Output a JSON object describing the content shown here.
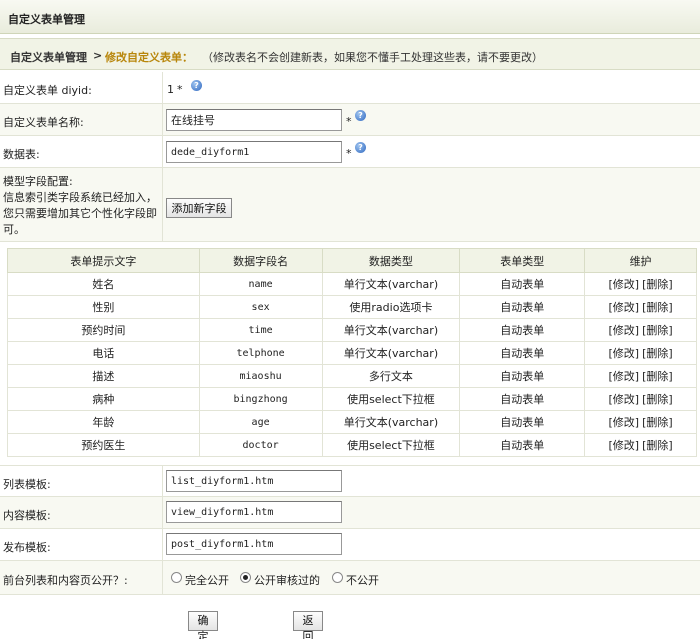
{
  "header": {
    "title": "自定义表单管理"
  },
  "breadcrumb": {
    "root": "自定义表单管理",
    "separator": ">",
    "current": "修改自定义表单：",
    "note": "（修改表名不会创建新表，如果您不懂手工处理这些表，请不要更改）"
  },
  "form": {
    "diyid_label": "自定义表单 diyid:",
    "diyid_value": "1",
    "name_label": "自定义表单名称:",
    "name_value": "在线挂号",
    "table_label": "数据表:",
    "table_value": "dede_diyform1",
    "required_mark": "*",
    "help_glyph": "?",
    "config_label_1": "模型字段配置:",
    "config_label_2": "信息索引类字段系统已经加入，",
    "config_label_3": "您只需要增加其它个性化字段即",
    "config_label_4": "可。",
    "add_field_button": "添加新字段",
    "list_tpl_label": "列表模板:",
    "list_tpl_value": "list_diyform1.htm",
    "view_tpl_label": "内容模板:",
    "view_tpl_value": "view_diyform1.htm",
    "post_tpl_label": "发布模板:",
    "post_tpl_value": "post_diyform1.htm",
    "public_label": "前台列表和内容页公开？:",
    "public_options": [
      "完全公开",
      "公开审核过的",
      "不公开"
    ],
    "public_selected": 1,
    "ok_button": "确定",
    "back_button": "返回"
  },
  "fields_table": {
    "headers": [
      "表单提示文字",
      "数据字段名",
      "数据类型",
      "表单类型",
      "维护"
    ],
    "edit_label": "[修改]",
    "delete_label": "[删除]",
    "rows": [
      {
        "label": "姓名",
        "field": "name",
        "dtype": "单行文本(varchar)",
        "ftype": "自动表单"
      },
      {
        "label": "性别",
        "field": "sex",
        "dtype": "使用radio选项卡",
        "ftype": "自动表单"
      },
      {
        "label": "预约时间",
        "field": "time",
        "dtype": "单行文本(varchar)",
        "ftype": "自动表单"
      },
      {
        "label": "电话",
        "field": "telphone",
        "dtype": "单行文本(varchar)",
        "ftype": "自动表单"
      },
      {
        "label": "描述",
        "field": "miaoshu",
        "dtype": "多行文本",
        "ftype": "自动表单"
      },
      {
        "label": "病种",
        "field": "bingzhong",
        "dtype": "使用select下拉框",
        "ftype": "自动表单"
      },
      {
        "label": "年龄",
        "field": "age",
        "dtype": "单行文本(varchar)",
        "ftype": "自动表单"
      },
      {
        "label": "预约医生",
        "field": "doctor",
        "dtype": "使用select下拉框",
        "ftype": "自动表单"
      }
    ]
  }
}
